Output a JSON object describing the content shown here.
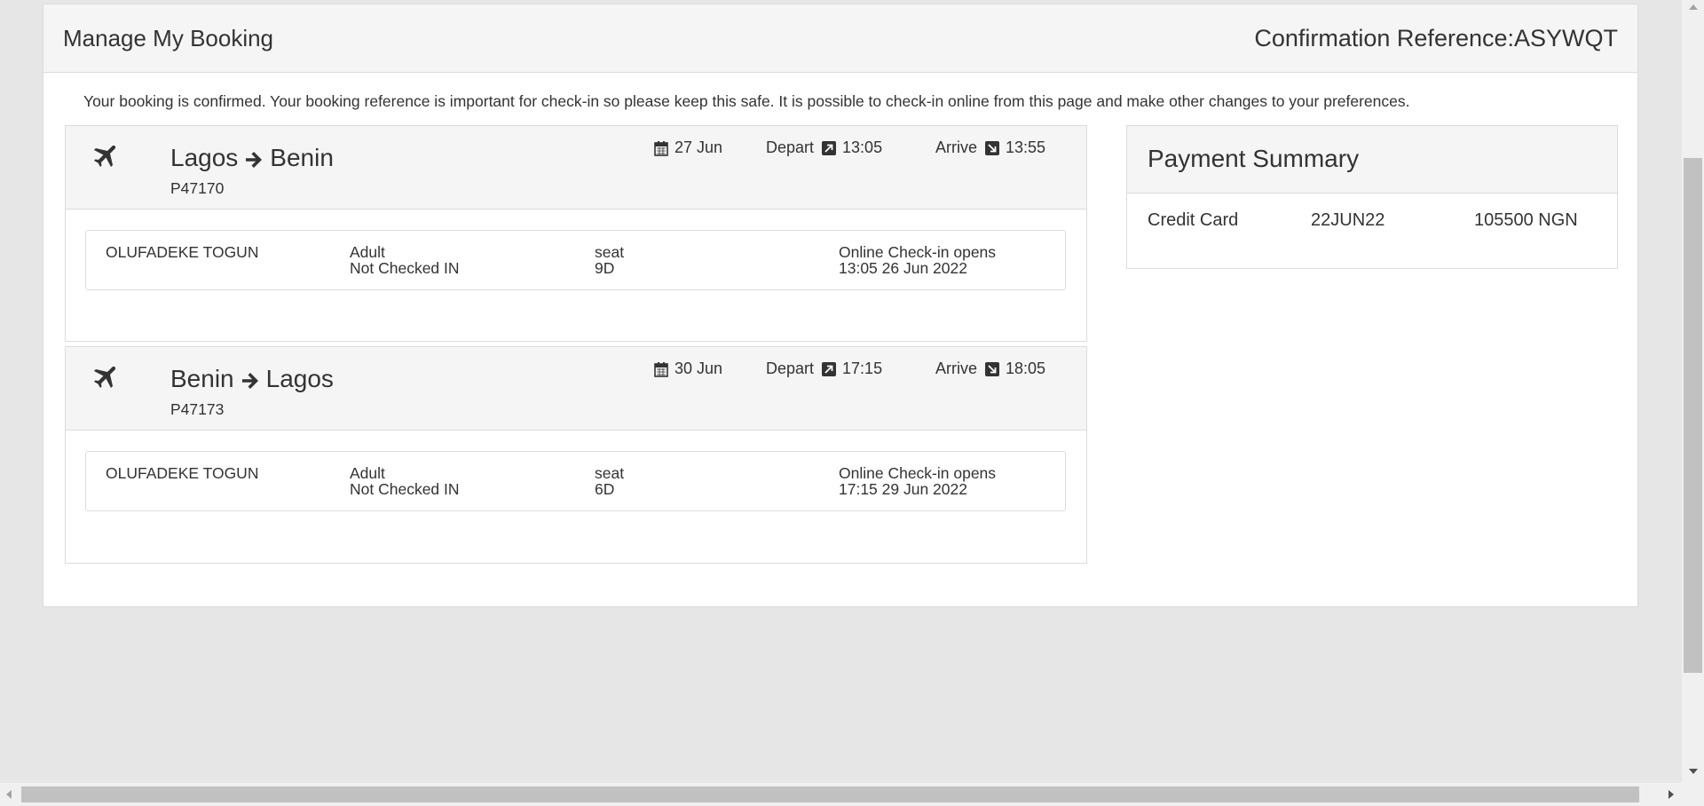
{
  "page": {
    "title": "Manage My Booking",
    "confirmation": "Confirmation Reference:ASYWQT",
    "notice": "Your booking is confirmed. Your booking reference is important for check-in so please keep this safe. It is possible to check-in online from this page and make other changes to your preferences."
  },
  "flights": [
    {
      "origin": "Lagos",
      "destination": "Benin",
      "flight_no": "P47170",
      "date": "27 Jun",
      "depart_label": "Depart",
      "depart_time": "13:05",
      "arrive_label": "Arrive",
      "arrive_time": "13:55",
      "passenger": {
        "name": "OLUFADEKE TOGUN",
        "type": "Adult",
        "status": "Not Checked IN",
        "seat_label": "seat",
        "seat": "9D",
        "checkin_label": "Online Check-in opens",
        "checkin_time": "13:05 26 Jun 2022"
      }
    },
    {
      "origin": "Benin",
      "destination": "Lagos",
      "flight_no": "P47173",
      "date": "30 Jun",
      "depart_label": "Depart",
      "depart_time": "17:15",
      "arrive_label": "Arrive",
      "arrive_time": "18:05",
      "passenger": {
        "name": "OLUFADEKE TOGUN",
        "type": "Adult",
        "status": "Not Checked IN",
        "seat_label": "seat",
        "seat": "6D",
        "checkin_label": "Online Check-in opens",
        "checkin_time": "17:15 29 Jun 2022"
      }
    }
  ],
  "payment": {
    "title": "Payment Summary",
    "method": "Credit Card",
    "date": "22JUN22",
    "amount": "105500 NGN"
  },
  "icons": {
    "plane": "plane-icon",
    "arrow": "arrow-right-icon",
    "calendar": "calendar-icon",
    "depart": "depart-arrow-icon",
    "arrive": "arrive-arrow-icon"
  },
  "colors": {
    "page_bg": "#e6e6e6",
    "panel_bg": "#ffffff",
    "header_bg": "#f5f5f5",
    "border": "#dcdcdc",
    "text": "#333333"
  }
}
